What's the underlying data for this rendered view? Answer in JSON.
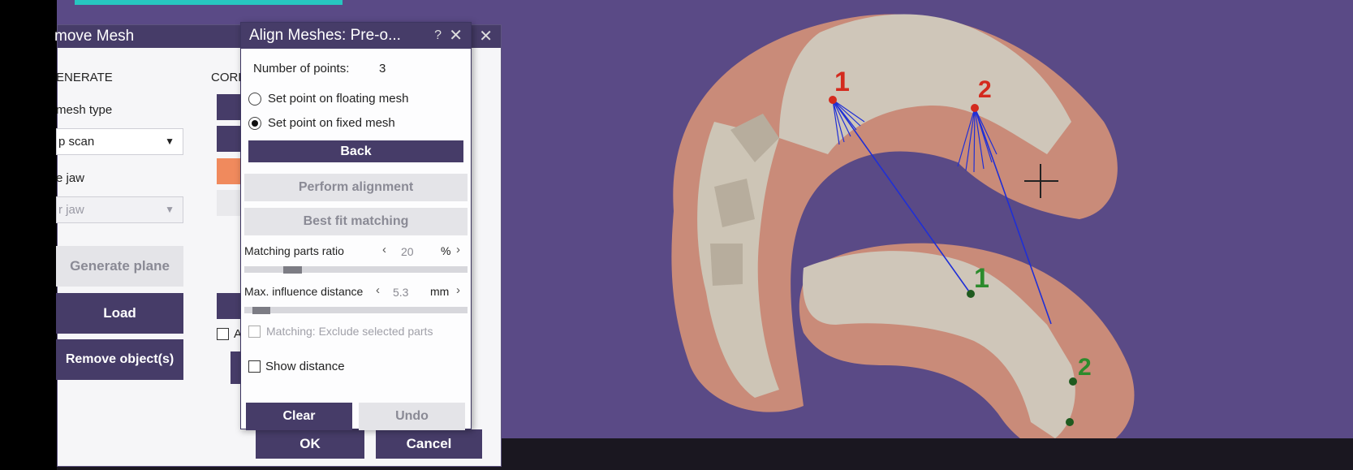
{
  "back_dialog": {
    "title": "move Mesh",
    "section_generate": "ENERATE",
    "section_corr": "CORR",
    "mesh_type_label": "mesh type",
    "mesh_type_value": "p scan",
    "jaw_label": "e jaw",
    "jaw_value": "r jaw",
    "generate_plane": "Generate plane",
    "load": "Load",
    "remove_objects": "Remove object(s)",
    "checkbox_label": "A",
    "ok": "OK",
    "cancel": "Cancel",
    "close_glyph": "✕"
  },
  "front_dialog": {
    "title": "Align Meshes: Pre-o...",
    "help_glyph": "?",
    "close_glyph": "✕",
    "num_points_label": "Number of points:",
    "num_points_value": "3",
    "radio_floating": "Set point on floating mesh",
    "radio_fixed": "Set point on fixed mesh",
    "back": "Back",
    "perform_alignment": "Perform alignment",
    "best_fit": "Best fit matching",
    "matching_ratio_label": "Matching parts ratio",
    "matching_ratio_value": "20",
    "matching_ratio_unit": "%",
    "max_influence_label": "Max. influence distance",
    "max_influence_value": "5.3",
    "max_influence_unit": "mm",
    "exclude_label": "Matching: Exclude selected parts",
    "show_distance": "Show distance",
    "clear": "Clear",
    "undo": "Undo"
  },
  "viewport": {
    "markers": {
      "upper_1": "1",
      "upper_2": "2",
      "lower_1": "1",
      "lower_2": "2"
    },
    "colors": {
      "background": "#5a4a86",
      "red_marker": "#d42a1e",
      "green_marker": "#2c8b2c",
      "line": "#1f2fd6"
    }
  },
  "colors": {
    "accent": "#463c68",
    "swatch": "#f08a5d"
  }
}
